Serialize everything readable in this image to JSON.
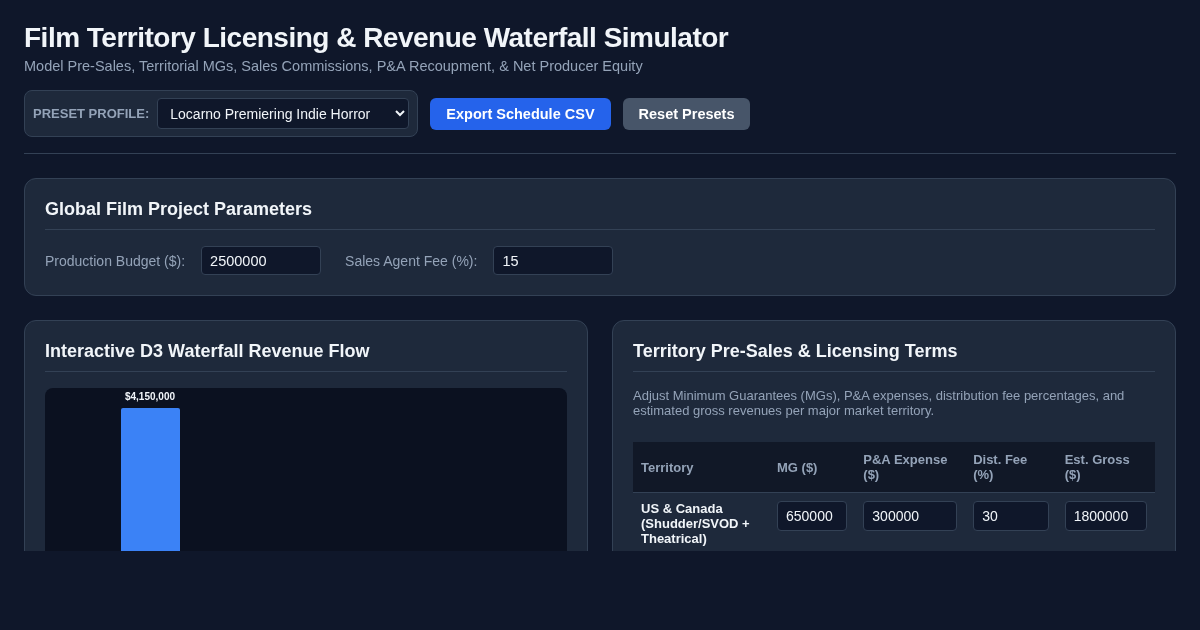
{
  "header": {
    "title": "Film Territory Licensing & Revenue Waterfall Simulator",
    "subtitle": "Model Pre-Sales, Territorial MGs, Sales Commissions, P&A Recoupment, & Net Producer Equity"
  },
  "toolbar": {
    "preset_label": "PRESET PROFILE:",
    "preset_value": "Locarno Premiering Indie Horror",
    "buttons": [
      {
        "label": "Export Schedule CSV",
        "kind": "primary"
      },
      {
        "label": "Reset Presets",
        "kind": "secondary"
      }
    ]
  },
  "global_params": {
    "title": "Global Film Project Parameters",
    "fields": [
      {
        "label": "Production Budget ($):",
        "value": "2500000"
      },
      {
        "label": "Sales Agent Fee (%):",
        "value": "15"
      }
    ]
  },
  "waterfall": {
    "title": "Interactive D3 Waterfall Revenue Flow",
    "bar_label": "$4,150,000"
  },
  "territories": {
    "title": "Territory Pre-Sales & Licensing Terms",
    "description": "Adjust Minimum Guarantees (MGs), P&A expenses, distribution fee percentages, and estimated gross revenues per major market territory.",
    "columns": [
      "Territory",
      "MG ($)",
      "P&A Expense ($)",
      "Dist. Fee (%)",
      "Est. Gross ($)"
    ],
    "rows": [
      {
        "territory": "US & Canada (Shudder/SVOD + Theatrical)",
        "values": [
          "650000",
          "300000",
          "30",
          "1800000"
        ]
      }
    ]
  }
}
